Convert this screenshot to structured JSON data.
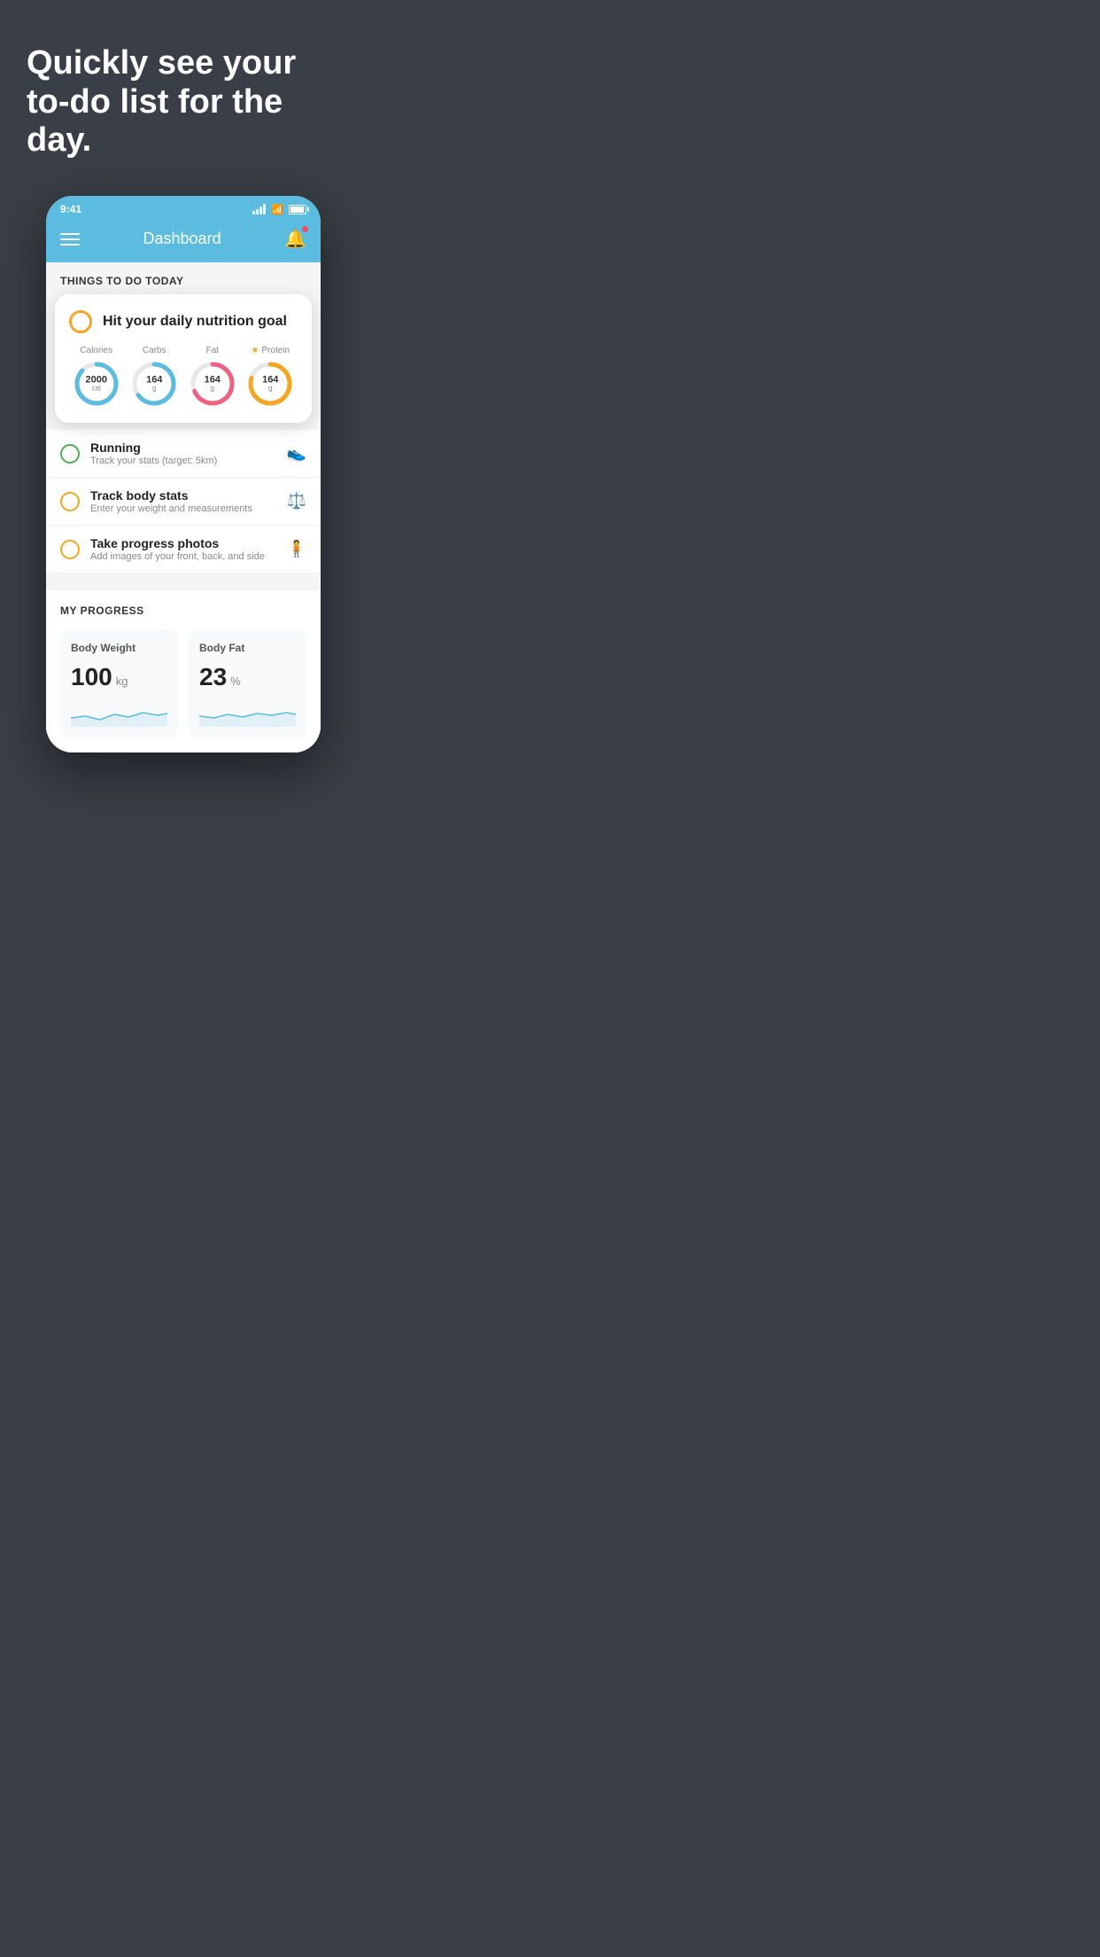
{
  "hero": {
    "title": "Quickly see your to-do list for the day."
  },
  "statusBar": {
    "time": "9:41"
  },
  "navBar": {
    "title": "Dashboard"
  },
  "todoSection": {
    "header": "THINGS TO DO TODAY"
  },
  "nutritionCard": {
    "checkCircleColor": "#f5a623",
    "title": "Hit your daily nutrition goal",
    "items": [
      {
        "label": "Calories",
        "value": "2000",
        "unit": "cal",
        "color": "blue",
        "star": false
      },
      {
        "label": "Carbs",
        "value": "164",
        "unit": "g",
        "color": "blue",
        "star": false
      },
      {
        "label": "Fat",
        "value": "164",
        "unit": "g",
        "color": "pink",
        "star": false
      },
      {
        "label": "Protein",
        "value": "164",
        "unit": "g",
        "color": "yellow",
        "star": true
      }
    ]
  },
  "todoItems": [
    {
      "title": "Running",
      "subtitle": "Track your stats (target: 5km)",
      "circleType": "green",
      "icon": "shoe"
    },
    {
      "title": "Track body stats",
      "subtitle": "Enter your weight and measurements",
      "circleType": "yellow",
      "icon": "scale"
    },
    {
      "title": "Take progress photos",
      "subtitle": "Add images of your front, back, and side",
      "circleType": "yellow",
      "icon": "person"
    }
  ],
  "progressSection": {
    "title": "MY PROGRESS",
    "cards": [
      {
        "title": "Body Weight",
        "value": "100",
        "unit": "kg"
      },
      {
        "title": "Body Fat",
        "value": "23",
        "unit": "%"
      }
    ]
  }
}
